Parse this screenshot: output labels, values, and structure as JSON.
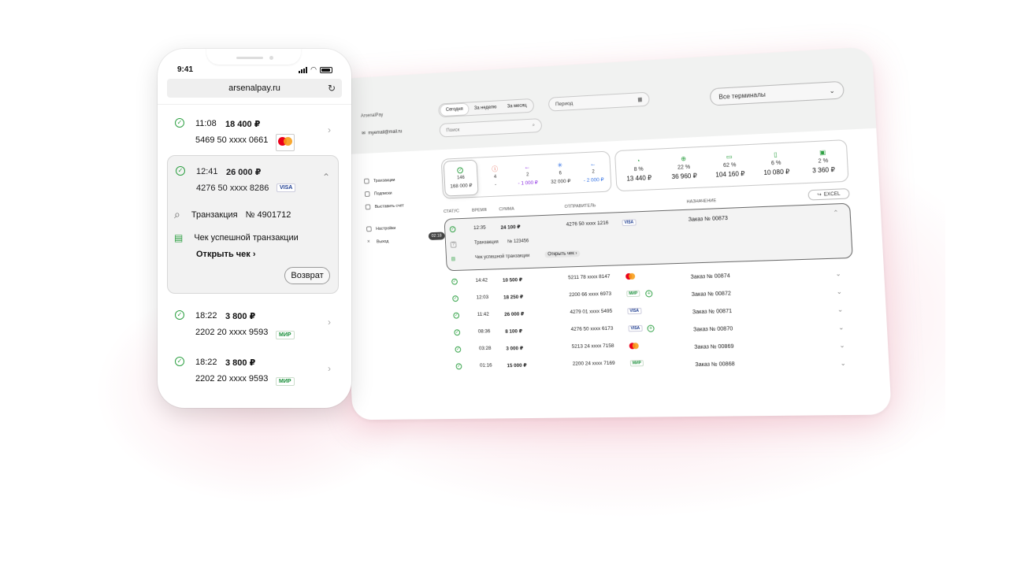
{
  "phone": {
    "clock": "9:41",
    "url": "arsenalpay.ru",
    "reload_icon": "reload-icon",
    "items": [
      {
        "time": "11:08",
        "amount": "18 400 ₽",
        "card": "5469 50 xxxx 0661",
        "pay": "mastercard"
      },
      {
        "time": "12:41",
        "amount": "26 000 ₽",
        "card": "4276 50 xxxx 8286",
        "pay": "VISA"
      },
      {
        "time": "18:22",
        "amount": "3 800 ₽",
        "card": "2202 20 xxxx 9593",
        "pay": "МИР"
      },
      {
        "time": "18:22",
        "amount": "3 800 ₽",
        "card": "2202 20 xxxx 9593",
        "pay": "МИР"
      }
    ],
    "expanded": {
      "transaction_label": "Транзакция",
      "transaction_no": "№ 4901712",
      "receipt_label": "Чек успешной транзакции",
      "open_receipt": "Открыть чек",
      "return_label": "Возврат"
    }
  },
  "desktop": {
    "logo": "ArsenalPay",
    "email": "myemail@mail.ru",
    "tabs": [
      "Сегодня",
      "За неделю",
      "За месяц"
    ],
    "period_placeholder": "Период",
    "search_placeholder": "Поиск",
    "terminals": "Все терминалы",
    "sidebar": [
      "Транзакции",
      "Подписки",
      "Выставить счет",
      "Настройки",
      "Выход"
    ],
    "clock_badge": "02:18",
    "stats_left": [
      {
        "count": "146",
        "sum": "168 000 ₽"
      },
      {
        "count": "4",
        "sum": "-"
      },
      {
        "count": "2",
        "sum": "- 1 000 ₽"
      },
      {
        "count": "6",
        "sum": "32 000 ₽"
      },
      {
        "count": "2",
        "sum": "- 2 000 ₽"
      }
    ],
    "stats_right": [
      {
        "pct": "8 %",
        "sum": "13 440 ₽"
      },
      {
        "pct": "22 %",
        "sum": "36 960 ₽"
      },
      {
        "pct": "62 %",
        "sum": "104 160 ₽"
      },
      {
        "pct": "6 %",
        "sum": "10 080 ₽"
      },
      {
        "pct": "2 %",
        "sum": "3 360 ₽"
      }
    ],
    "columns": {
      "status": "СТАТУС",
      "time": "ВРЕМЯ",
      "sum": "СУММА",
      "sender": "ОТПРАВИТЕЛЬ",
      "purpose": "НАЗНАЧЕНИЕ"
    },
    "excel": "EXCEL",
    "expanded_row": {
      "time": "12:35",
      "sum": "24 100 ₽",
      "card": "4276 50 xxxx 1216",
      "pay": "VISA",
      "purpose": "Заказ № 00873",
      "transaction_label": "Транзакция",
      "transaction_no": "№ 123456",
      "receipt_label": "Чек успешной транзакции",
      "open_receipt": "Открыть чек"
    },
    "rows": [
      {
        "time": "14:42",
        "sum": "10 500 ₽",
        "card": "5211 78 xxxx 8147",
        "pay": "mastercard",
        "purpose": "Заказ № 00874"
      },
      {
        "time": "12:03",
        "sum": "18 250 ₽",
        "card": "2200 66 xxxx 6973",
        "pay": "МИР",
        "purpose": "Заказ № 00872"
      },
      {
        "time": "11:42",
        "sum": "26 000 ₽",
        "card": "4279 01 xxxx 5495",
        "pay": "VISA",
        "purpose": "Заказ № 00871"
      },
      {
        "time": "08:36",
        "sum": "8 100 ₽",
        "card": "4276 50 xxxx 6173",
        "pay": "VISA",
        "purpose": "Заказ № 00870"
      },
      {
        "time": "03:28",
        "sum": "3 000 ₽",
        "card": "5213 24 xxxx 7158",
        "pay": "mastercard",
        "purpose": "Заказ № 00869"
      },
      {
        "time": "01:16",
        "sum": "15 000 ₽",
        "card": "2200 24 xxxx 7169",
        "pay": "МИР",
        "purpose": "Заказ № 00868"
      }
    ]
  },
  "colors": {
    "success": "#2ea043",
    "accent_purple": "#8a2be2",
    "accent_blue": "#2f6fe4",
    "error": "#e5533d"
  }
}
